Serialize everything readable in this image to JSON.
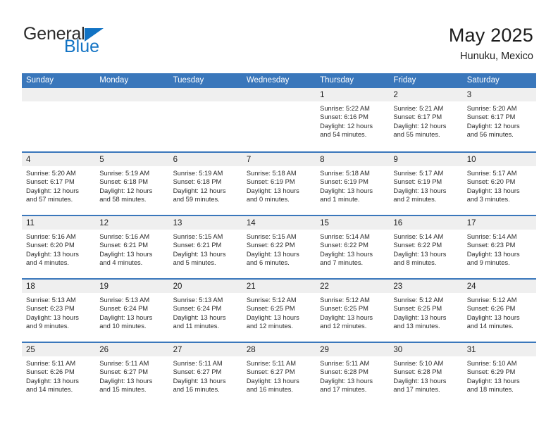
{
  "logo": {
    "word_one": "General",
    "word_two": "Blue",
    "triangle_color": "#1273c4"
  },
  "header": {
    "title": "May 2025",
    "location": "Hunuku, Mexico",
    "header_bg": "#3a77bb",
    "daynum_bg": "#efefef"
  },
  "weekdays": [
    "Sunday",
    "Monday",
    "Tuesday",
    "Wednesday",
    "Thursday",
    "Friday",
    "Saturday"
  ],
  "weeks": [
    [
      {
        "day": "",
        "empty": true
      },
      {
        "day": "",
        "empty": true
      },
      {
        "day": "",
        "empty": true
      },
      {
        "day": "",
        "empty": true
      },
      {
        "day": "1",
        "sunrise": "Sunrise: 5:22 AM",
        "sunset": "Sunset: 6:16 PM",
        "daylight1": "Daylight: 12 hours",
        "daylight2": "and 54 minutes."
      },
      {
        "day": "2",
        "sunrise": "Sunrise: 5:21 AM",
        "sunset": "Sunset: 6:17 PM",
        "daylight1": "Daylight: 12 hours",
        "daylight2": "and 55 minutes."
      },
      {
        "day": "3",
        "sunrise": "Sunrise: 5:20 AM",
        "sunset": "Sunset: 6:17 PM",
        "daylight1": "Daylight: 12 hours",
        "daylight2": "and 56 minutes."
      }
    ],
    [
      {
        "day": "4",
        "sunrise": "Sunrise: 5:20 AM",
        "sunset": "Sunset: 6:17 PM",
        "daylight1": "Daylight: 12 hours",
        "daylight2": "and 57 minutes."
      },
      {
        "day": "5",
        "sunrise": "Sunrise: 5:19 AM",
        "sunset": "Sunset: 6:18 PM",
        "daylight1": "Daylight: 12 hours",
        "daylight2": "and 58 minutes."
      },
      {
        "day": "6",
        "sunrise": "Sunrise: 5:19 AM",
        "sunset": "Sunset: 6:18 PM",
        "daylight1": "Daylight: 12 hours",
        "daylight2": "and 59 minutes."
      },
      {
        "day": "7",
        "sunrise": "Sunrise: 5:18 AM",
        "sunset": "Sunset: 6:19 PM",
        "daylight1": "Daylight: 13 hours",
        "daylight2": "and 0 minutes."
      },
      {
        "day": "8",
        "sunrise": "Sunrise: 5:18 AM",
        "sunset": "Sunset: 6:19 PM",
        "daylight1": "Daylight: 13 hours",
        "daylight2": "and 1 minute."
      },
      {
        "day": "9",
        "sunrise": "Sunrise: 5:17 AM",
        "sunset": "Sunset: 6:19 PM",
        "daylight1": "Daylight: 13 hours",
        "daylight2": "and 2 minutes."
      },
      {
        "day": "10",
        "sunrise": "Sunrise: 5:17 AM",
        "sunset": "Sunset: 6:20 PM",
        "daylight1": "Daylight: 13 hours",
        "daylight2": "and 3 minutes."
      }
    ],
    [
      {
        "day": "11",
        "sunrise": "Sunrise: 5:16 AM",
        "sunset": "Sunset: 6:20 PM",
        "daylight1": "Daylight: 13 hours",
        "daylight2": "and 4 minutes."
      },
      {
        "day": "12",
        "sunrise": "Sunrise: 5:16 AM",
        "sunset": "Sunset: 6:21 PM",
        "daylight1": "Daylight: 13 hours",
        "daylight2": "and 4 minutes."
      },
      {
        "day": "13",
        "sunrise": "Sunrise: 5:15 AM",
        "sunset": "Sunset: 6:21 PM",
        "daylight1": "Daylight: 13 hours",
        "daylight2": "and 5 minutes."
      },
      {
        "day": "14",
        "sunrise": "Sunrise: 5:15 AM",
        "sunset": "Sunset: 6:22 PM",
        "daylight1": "Daylight: 13 hours",
        "daylight2": "and 6 minutes."
      },
      {
        "day": "15",
        "sunrise": "Sunrise: 5:14 AM",
        "sunset": "Sunset: 6:22 PM",
        "daylight1": "Daylight: 13 hours",
        "daylight2": "and 7 minutes."
      },
      {
        "day": "16",
        "sunrise": "Sunrise: 5:14 AM",
        "sunset": "Sunset: 6:22 PM",
        "daylight1": "Daylight: 13 hours",
        "daylight2": "and 8 minutes."
      },
      {
        "day": "17",
        "sunrise": "Sunrise: 5:14 AM",
        "sunset": "Sunset: 6:23 PM",
        "daylight1": "Daylight: 13 hours",
        "daylight2": "and 9 minutes."
      }
    ],
    [
      {
        "day": "18",
        "sunrise": "Sunrise: 5:13 AM",
        "sunset": "Sunset: 6:23 PM",
        "daylight1": "Daylight: 13 hours",
        "daylight2": "and 9 minutes."
      },
      {
        "day": "19",
        "sunrise": "Sunrise: 5:13 AM",
        "sunset": "Sunset: 6:24 PM",
        "daylight1": "Daylight: 13 hours",
        "daylight2": "and 10 minutes."
      },
      {
        "day": "20",
        "sunrise": "Sunrise: 5:13 AM",
        "sunset": "Sunset: 6:24 PM",
        "daylight1": "Daylight: 13 hours",
        "daylight2": "and 11 minutes."
      },
      {
        "day": "21",
        "sunrise": "Sunrise: 5:12 AM",
        "sunset": "Sunset: 6:25 PM",
        "daylight1": "Daylight: 13 hours",
        "daylight2": "and 12 minutes."
      },
      {
        "day": "22",
        "sunrise": "Sunrise: 5:12 AM",
        "sunset": "Sunset: 6:25 PM",
        "daylight1": "Daylight: 13 hours",
        "daylight2": "and 12 minutes."
      },
      {
        "day": "23",
        "sunrise": "Sunrise: 5:12 AM",
        "sunset": "Sunset: 6:25 PM",
        "daylight1": "Daylight: 13 hours",
        "daylight2": "and 13 minutes."
      },
      {
        "day": "24",
        "sunrise": "Sunrise: 5:12 AM",
        "sunset": "Sunset: 6:26 PM",
        "daylight1": "Daylight: 13 hours",
        "daylight2": "and 14 minutes."
      }
    ],
    [
      {
        "day": "25",
        "sunrise": "Sunrise: 5:11 AM",
        "sunset": "Sunset: 6:26 PM",
        "daylight1": "Daylight: 13 hours",
        "daylight2": "and 14 minutes."
      },
      {
        "day": "26",
        "sunrise": "Sunrise: 5:11 AM",
        "sunset": "Sunset: 6:27 PM",
        "daylight1": "Daylight: 13 hours",
        "daylight2": "and 15 minutes."
      },
      {
        "day": "27",
        "sunrise": "Sunrise: 5:11 AM",
        "sunset": "Sunset: 6:27 PM",
        "daylight1": "Daylight: 13 hours",
        "daylight2": "and 16 minutes."
      },
      {
        "day": "28",
        "sunrise": "Sunrise: 5:11 AM",
        "sunset": "Sunset: 6:27 PM",
        "daylight1": "Daylight: 13 hours",
        "daylight2": "and 16 minutes."
      },
      {
        "day": "29",
        "sunrise": "Sunrise: 5:11 AM",
        "sunset": "Sunset: 6:28 PM",
        "daylight1": "Daylight: 13 hours",
        "daylight2": "and 17 minutes."
      },
      {
        "day": "30",
        "sunrise": "Sunrise: 5:10 AM",
        "sunset": "Sunset: 6:28 PM",
        "daylight1": "Daylight: 13 hours",
        "daylight2": "and 17 minutes."
      },
      {
        "day": "31",
        "sunrise": "Sunrise: 5:10 AM",
        "sunset": "Sunset: 6:29 PM",
        "daylight1": "Daylight: 13 hours",
        "daylight2": "and 18 minutes."
      }
    ]
  ]
}
